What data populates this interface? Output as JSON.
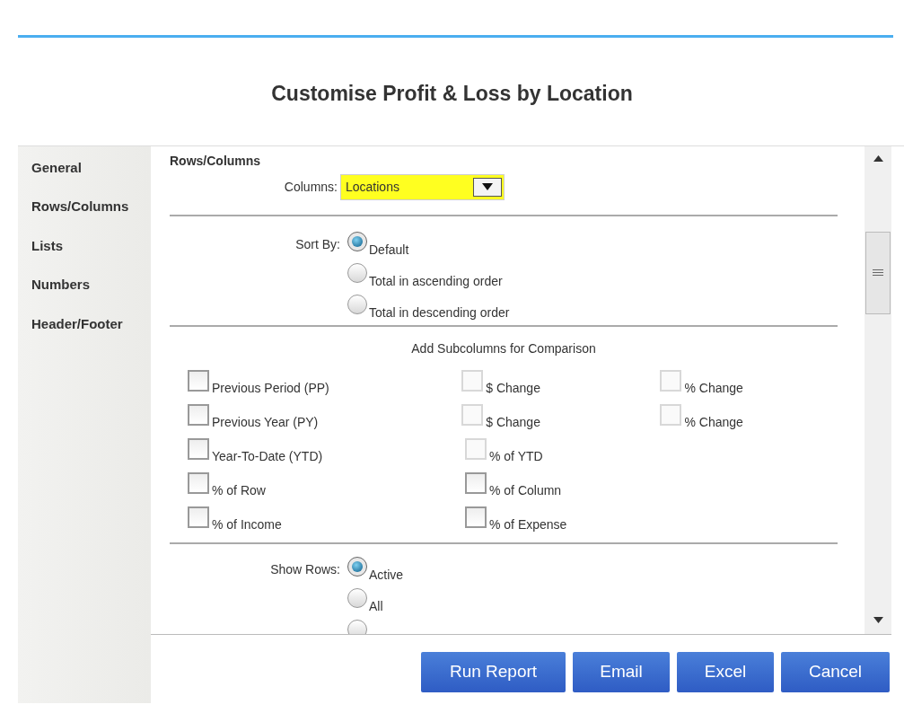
{
  "title": "Customise Profit & Loss by Location",
  "sidebar": {
    "items": [
      {
        "label": "General"
      },
      {
        "label": "Rows/Columns"
      },
      {
        "label": "Lists"
      },
      {
        "label": "Numbers"
      },
      {
        "label": "Header/Footer"
      }
    ]
  },
  "section_title": "Rows/Columns",
  "columns_field": {
    "label": "Columns:",
    "value": "Locations"
  },
  "sort_by": {
    "label": "Sort By:",
    "options": [
      {
        "label": "Default",
        "selected": true
      },
      {
        "label": "Total in ascending order",
        "selected": false
      },
      {
        "label": "Total in descending order",
        "selected": false
      }
    ]
  },
  "subcolumns": {
    "title": "Add Subcolumns for Comparison",
    "rows": [
      [
        {
          "label": "Previous Period (PP)",
          "checked": false,
          "disabled": false
        },
        {
          "label": "$ Change",
          "checked": false,
          "disabled": true
        },
        {
          "label": "% Change",
          "checked": false,
          "disabled": true
        }
      ],
      [
        {
          "label": "Previous Year (PY)",
          "checked": false,
          "disabled": false
        },
        {
          "label": "$ Change",
          "checked": false,
          "disabled": true
        },
        {
          "label": "% Change",
          "checked": false,
          "disabled": true
        }
      ],
      [
        {
          "label": "Year-To-Date (YTD)",
          "checked": false,
          "disabled": false
        },
        {
          "label": "% of YTD",
          "checked": false,
          "disabled": true
        }
      ],
      [
        {
          "label": "% of Row",
          "checked": false,
          "disabled": false
        },
        {
          "label": "% of Column",
          "checked": false,
          "disabled": false
        }
      ],
      [
        {
          "label": "% of Income",
          "checked": false,
          "disabled": false
        },
        {
          "label": "% of Expense",
          "checked": false,
          "disabled": false
        }
      ]
    ]
  },
  "show_rows": {
    "label": "Show Rows:",
    "options": [
      {
        "label": "Active",
        "selected": true
      },
      {
        "label": "All",
        "selected": false
      },
      {
        "selected": false
      }
    ]
  },
  "buttons": [
    "Run Report",
    "Email",
    "Excel",
    "Cancel"
  ]
}
